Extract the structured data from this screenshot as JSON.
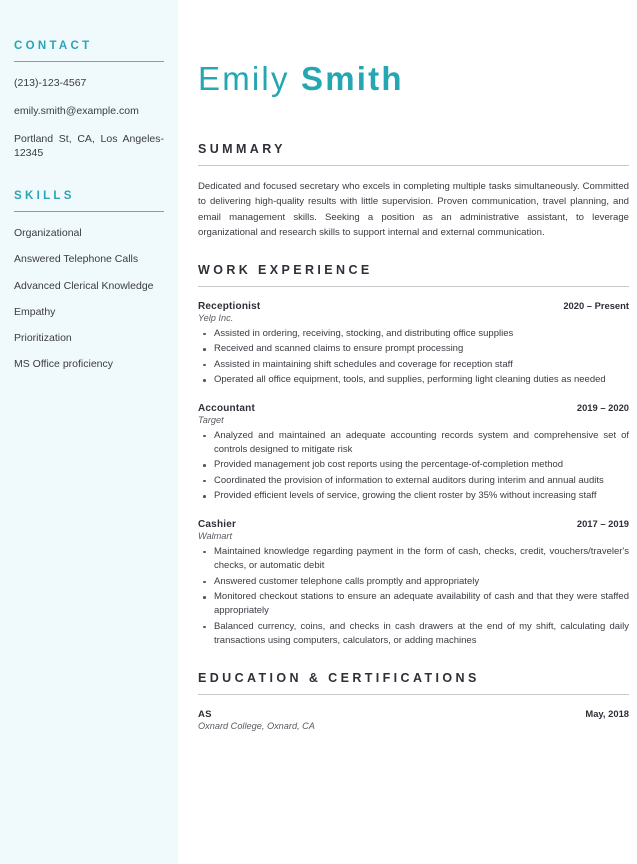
{
  "theme": {
    "accent": "#29a5b4",
    "sidebar_bg": "#f0fafd",
    "text": "#3b3b43",
    "heading": "#2f2f38",
    "rule_sidebar": "#8e9aa6",
    "rule_main": "#c9c9cd"
  },
  "header": {
    "first_name": "Emily",
    "last_name": "Smith"
  },
  "sidebar": {
    "contact": {
      "heading": "CONTACT",
      "items": [
        "(213)-123-4567",
        "emily.smith@example.com",
        "Portland St, CA, Los Angeles-12345"
      ]
    },
    "skills": {
      "heading": "SKILLS",
      "items": [
        "Organizational",
        "Answered Telephone Calls",
        "Advanced Clerical Knowledge",
        "Empathy",
        "Prioritization",
        "MS Office proficiency"
      ]
    }
  },
  "main": {
    "summary": {
      "heading": "SUMMARY",
      "text": "Dedicated and focused secretary who excels in completing multiple tasks simultaneously. Committed to delivering high-quality results with little supervision. Proven communication, travel planning, and email management skills. Seeking a position as an administrative assistant, to leverage organizational and research skills to support internal and external communication."
    },
    "work_experience": {
      "heading": "WORK EXPERIENCE",
      "jobs": [
        {
          "title": "Receptionist",
          "date": "2020 – Present",
          "organization": "Yelp Inc.",
          "bullets": [
            "Assisted in ordering, receiving, stocking, and distributing office supplies",
            "Received and scanned claims to ensure prompt processing",
            "Assisted in maintaining shift schedules and coverage for reception staff",
            "Operated all office equipment, tools, and supplies, performing light cleaning duties as needed"
          ]
        },
        {
          "title": "Accountant",
          "date": "2019 – 2020",
          "organization": "Target",
          "bullets": [
            "Analyzed and maintained an adequate accounting records system and comprehensive set of controls designed to mitigate risk",
            "Provided management job cost reports using the percentage-of-completion method",
            "Coordinated the provision of information to external auditors during interim and annual audits",
            "Provided efficient levels of service, growing the client roster by 35% without increasing staff"
          ]
        },
        {
          "title": "Cashier",
          "date": "2017 – 2019",
          "organization": "Walmart",
          "bullets": [
            "Maintained knowledge regarding payment in the form of cash, checks, credit, vouchers/traveler's checks, or automatic debit",
            "Answered customer telephone calls promptly and appropriately",
            "Monitored checkout stations to ensure an adequate availability of cash and that they were staffed appropriately",
            "Balanced currency, coins, and checks in cash drawers at the end of my shift, calculating daily transactions using computers, calculators, or adding machines"
          ]
        }
      ]
    },
    "education": {
      "heading": "EDUCATION & CERTIFICATIONS",
      "items": [
        {
          "degree": "AS",
          "date": "May, 2018",
          "school": "Oxnard College, Oxnard, CA"
        }
      ]
    }
  }
}
